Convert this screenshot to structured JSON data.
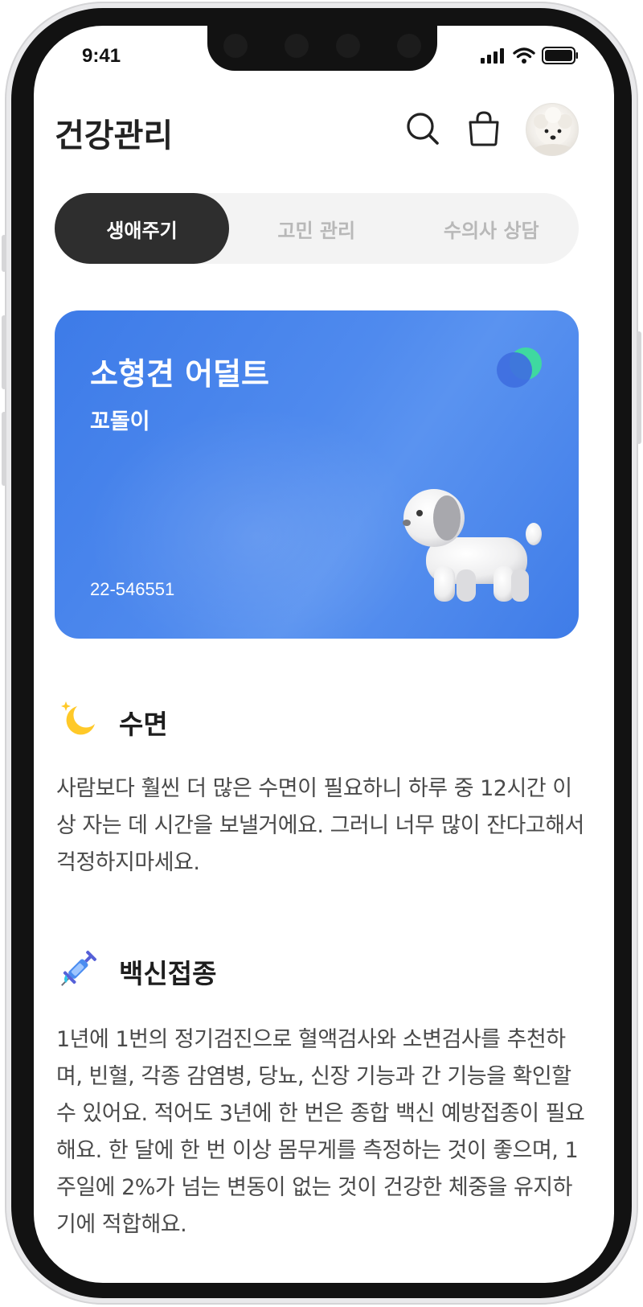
{
  "status_bar": {
    "time": "9:41"
  },
  "header": {
    "title": "건강관리"
  },
  "tabs": [
    {
      "label": "생애주기",
      "active": true
    },
    {
      "label": "고민 관리",
      "active": false
    },
    {
      "label": "수의사 상담",
      "active": false
    }
  ],
  "pet_card": {
    "title": "소형견 어덜트",
    "name": "꼬돌이",
    "number": "22-546551",
    "color": "#4a86ec"
  },
  "sections": [
    {
      "icon": "moon-icon",
      "title": "수면",
      "body": "사람보다 훨씬 더 많은 수면이 필요하니 하루 중 12시간 이상 자는 데 시간을 보낼거에요. 그러니 너무 많이 잔다고해서 걱정하지마세요."
    },
    {
      "icon": "syringe-icon",
      "title": "백신접종",
      "body": "1년에 1번의 정기검진으로 혈액검사와 소변검사를 추천하며, 빈혈, 각종 감염병, 당뇨, 신장 기능과 간 기능을 확인할 수 있어요. 적어도 3년에 한 번은 종합 백신 예방접종이 필요해요. 한 달에 한 번 이상 몸무게를 측정하는 것이 좋으며, 1주일에 2%가 넘는 변동이 없는 것이 건강한 체중을 유지하기에 적합해요."
    }
  ]
}
